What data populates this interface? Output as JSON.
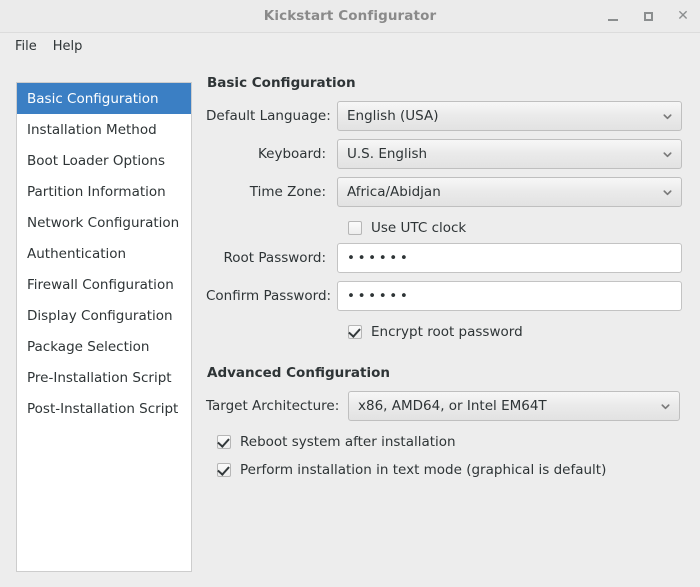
{
  "window": {
    "title": "Kickstart Configurator",
    "controls": {
      "minimize": "minimize-button",
      "maximize": "maximize-button",
      "close": "close-button"
    }
  },
  "menubar": {
    "items": [
      {
        "label": "File"
      },
      {
        "label": "Help"
      }
    ]
  },
  "sidebar": {
    "selected_index": 0,
    "items": [
      {
        "label": "Basic Configuration"
      },
      {
        "label": "Installation Method"
      },
      {
        "label": "Boot Loader Options"
      },
      {
        "label": "Partition Information"
      },
      {
        "label": "Network Configuration"
      },
      {
        "label": "Authentication"
      },
      {
        "label": "Firewall Configuration"
      },
      {
        "label": "Display Configuration"
      },
      {
        "label": "Package Selection"
      },
      {
        "label": "Pre-Installation Script"
      },
      {
        "label": "Post-Installation Script"
      }
    ]
  },
  "basic": {
    "heading": "Basic Configuration",
    "default_language": {
      "label": "Default Language:",
      "value": "English (USA)"
    },
    "keyboard": {
      "label": "Keyboard:",
      "value": "U.S. English"
    },
    "time_zone": {
      "label": "Time Zone:",
      "value": "Africa/Abidjan"
    },
    "use_utc_clock": {
      "label": "Use UTC clock",
      "checked": false
    },
    "root_password": {
      "label": "Root Password:",
      "value": "••••••"
    },
    "confirm_password": {
      "label": "Confirm Password:",
      "value": "••••••"
    },
    "encrypt_root_password": {
      "label": "Encrypt root password",
      "checked": true
    }
  },
  "advanced": {
    "heading": "Advanced Configuration",
    "target_architecture": {
      "label": "Target Architecture:",
      "value": "x86, AMD64, or Intel EM64T"
    },
    "reboot_after_install": {
      "label": "Reboot system after installation",
      "checked": true
    },
    "text_mode_install": {
      "label": "Perform installation in text mode (graphical is default)",
      "checked": true
    }
  },
  "colors": {
    "selection_blue": "#3b7fc4",
    "window_bg": "#ededed",
    "list_bg": "#ffffff",
    "text": "#2e3436",
    "title_text": "#8a8a8a"
  }
}
